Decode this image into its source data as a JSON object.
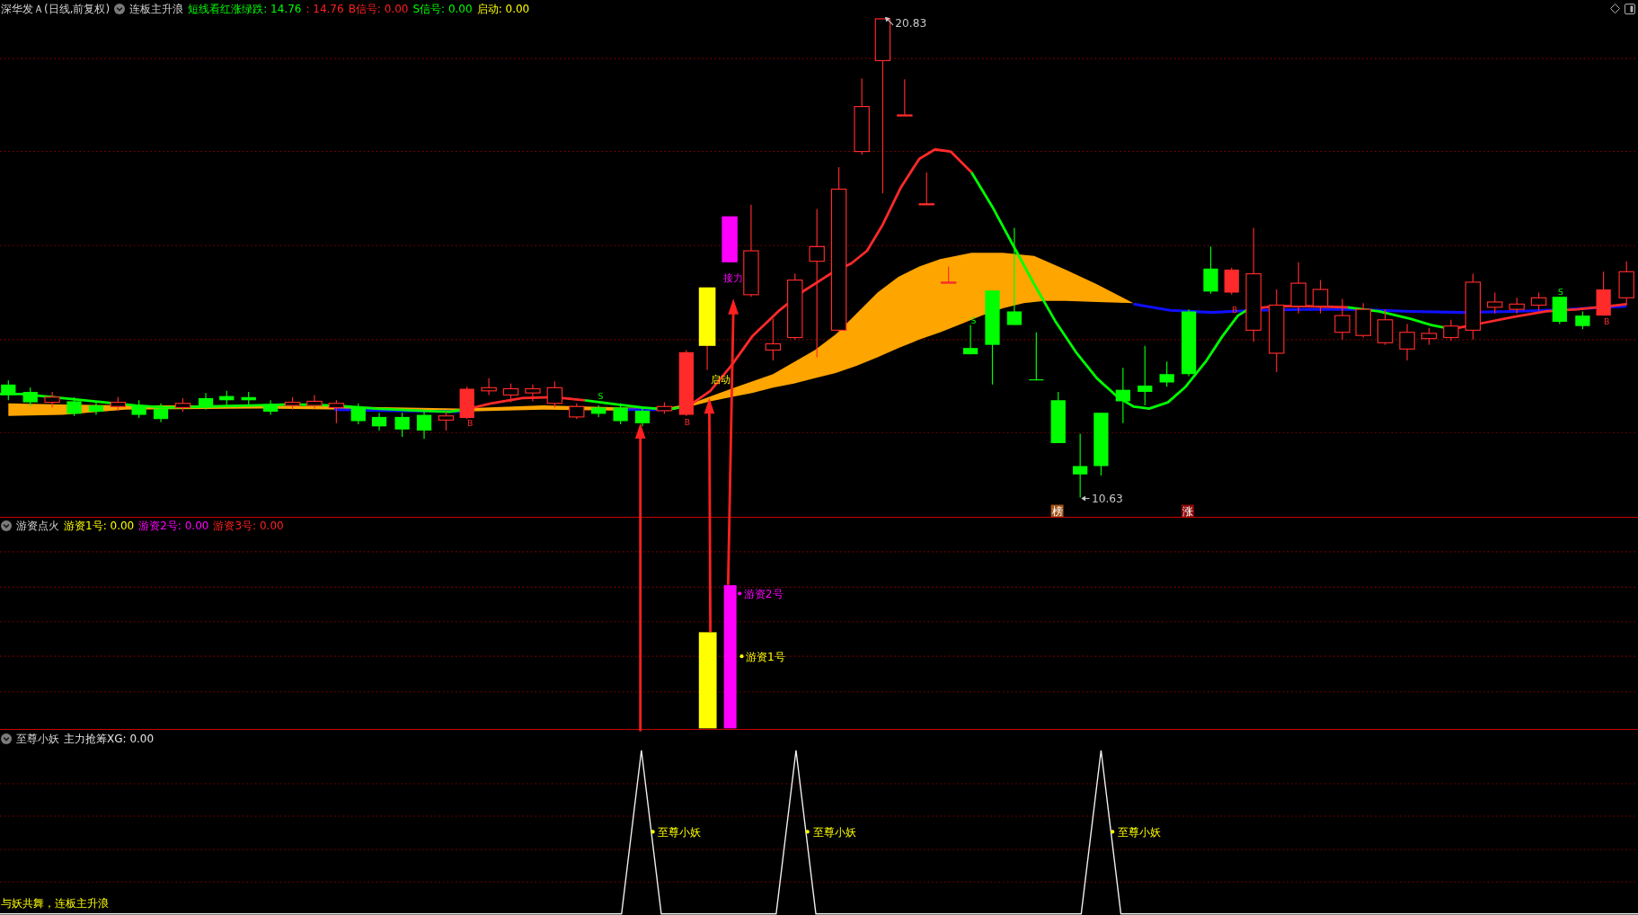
{
  "main_panel": {
    "stock_title": "深华发Ａ(日线,前复权)",
    "indicator": "连板主升浪",
    "readings": [
      {
        "text": "短线看红涨绿跌: 14.76",
        "color": "#00ff00"
      },
      {
        "text": ": 14.76",
        "color": "#ff2020"
      },
      {
        "text": "B信号: 0.00",
        "color": "#ff2020"
      },
      {
        "text": "S信号: 0.00",
        "color": "#00ff00"
      },
      {
        "text": "启动: 0.00",
        "color": "#ffff00"
      }
    ],
    "price_marks": [
      {
        "kind": "high",
        "text": "20.83"
      },
      {
        "kind": "low",
        "text": "10.63"
      }
    ],
    "signal_labels": [
      {
        "text": "启动",
        "color": "#ffff00"
      },
      {
        "text": "接力",
        "color": "#ff00ff"
      }
    ],
    "trade_marks": [
      {
        "kind": "buy",
        "text": "B"
      },
      {
        "kind": "sell",
        "text": "S"
      },
      {
        "kind": "buy",
        "text": "B"
      },
      {
        "kind": "sell",
        "text": "S"
      },
      {
        "kind": "buy",
        "text": "B"
      },
      {
        "kind": "sell",
        "text": "S"
      },
      {
        "kind": "buy",
        "text": "B"
      }
    ],
    "badges": [
      {
        "text": "榜",
        "color": "#a0561a"
      },
      {
        "text": "涨",
        "color": "#8b0a0a"
      }
    ]
  },
  "middle_panel": {
    "indicator": "游资点火",
    "readings": [
      {
        "text": "游资1号: 0.00",
        "color": "#ffff00"
      },
      {
        "text": "游资2号: 0.00",
        "color": "#ff00ff"
      },
      {
        "text": "游资3号: 0.00",
        "color": "#ff2020"
      }
    ],
    "bar_labels": [
      {
        "text": "游资2号",
        "color": "#ff00ff"
      },
      {
        "text": "游资1号",
        "color": "#ffff00"
      }
    ]
  },
  "bottom_panel": {
    "indicator": "至尊小妖",
    "readings": [
      {
        "text": "主力抢筹XG: 0.00"
      }
    ],
    "peak_labels": [
      "至尊小妖",
      "至尊小妖",
      "至尊小妖"
    ],
    "footer": "与妖共舞，连板主升浪"
  }
}
